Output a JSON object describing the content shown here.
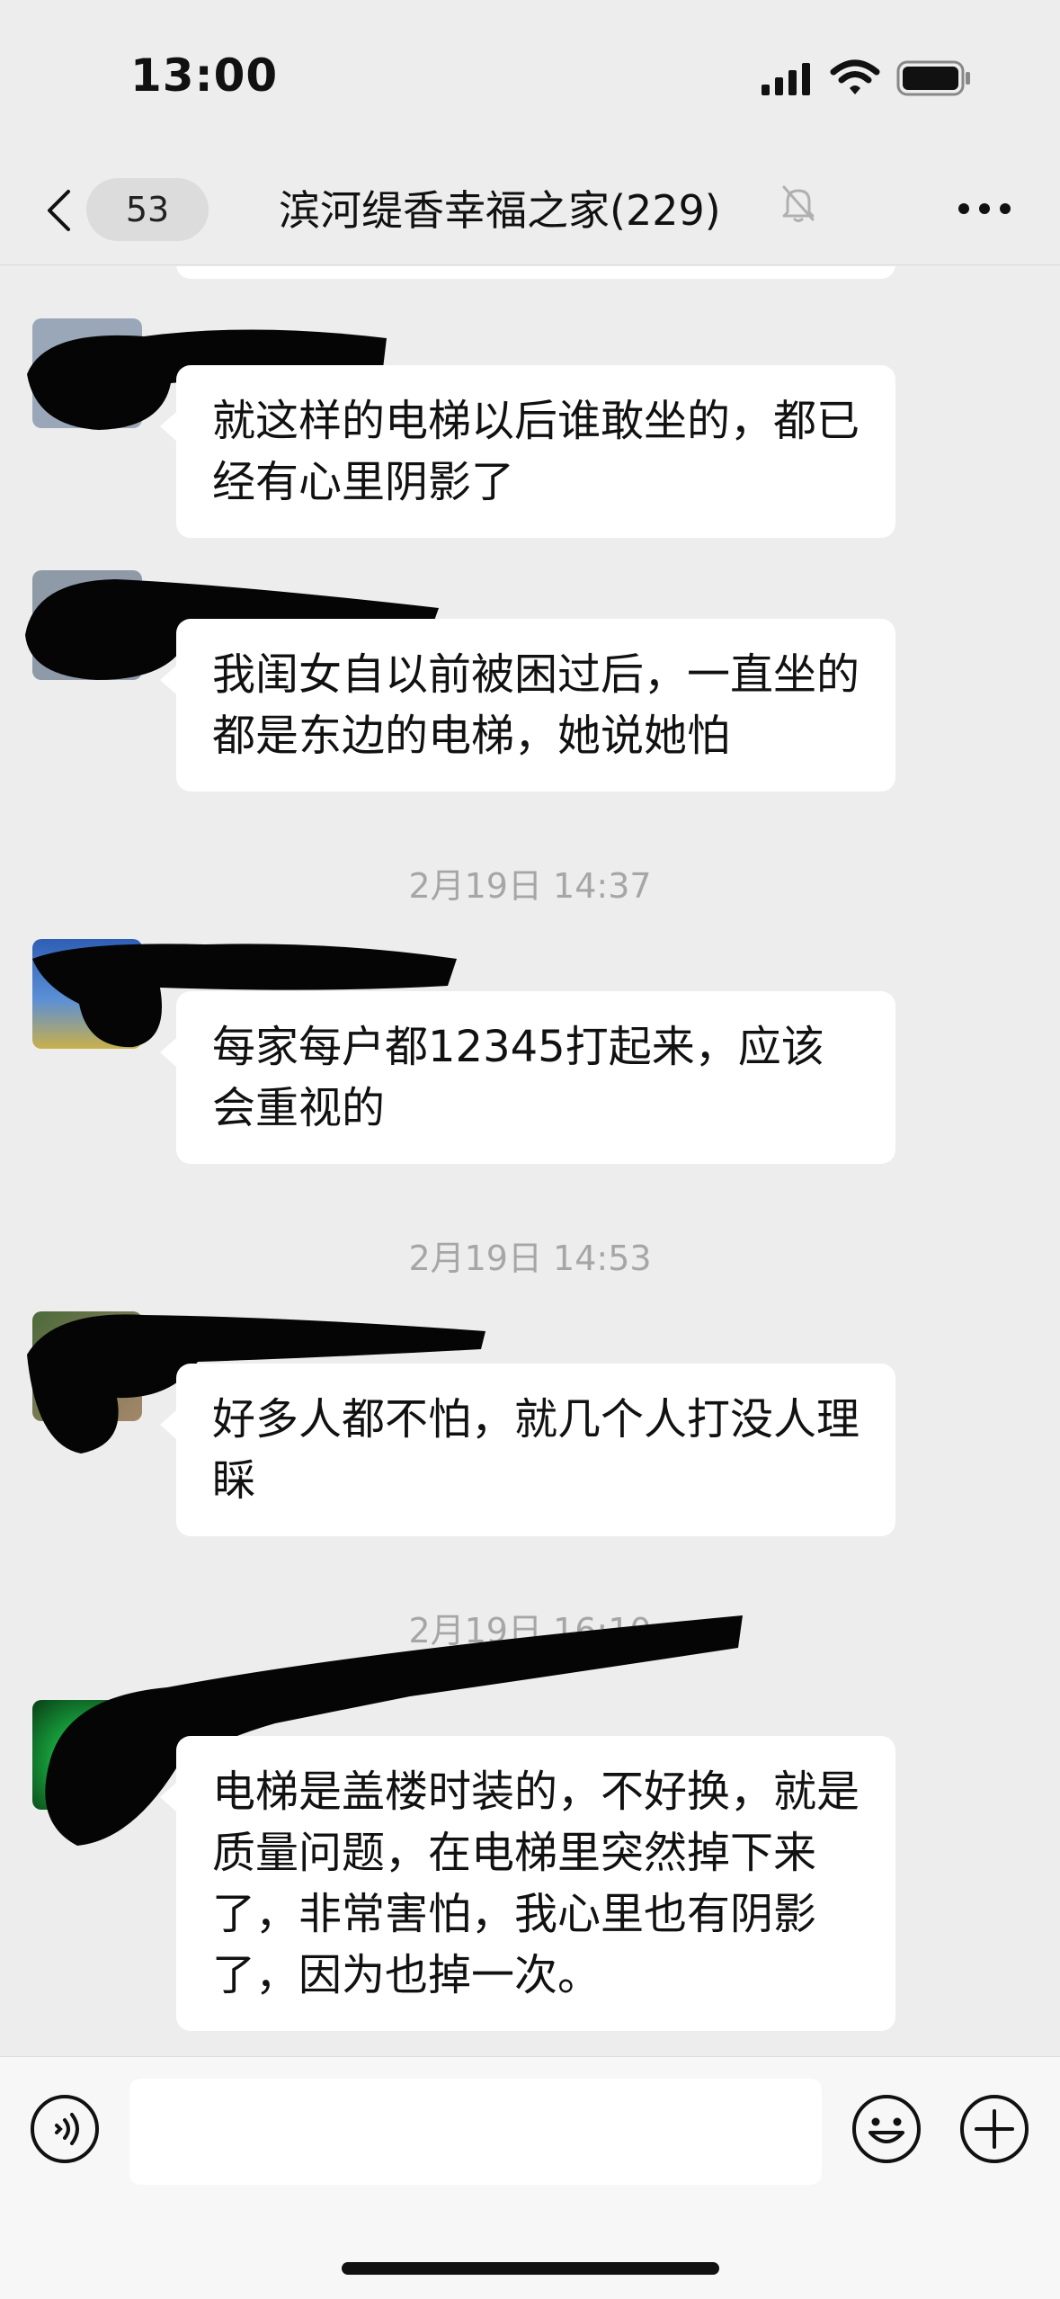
{
  "status_bar": {
    "time": "13:00"
  },
  "nav": {
    "unread_count": "53",
    "title": "滨河缇香幸福之家(229)",
    "muted": true
  },
  "messages": [
    {
      "type": "text",
      "text": "就这样的电梯以后谁敢坐的，都已经有心里阴影了"
    },
    {
      "type": "text",
      "text": "我闺女自以前被困过后，一直坐的都是东边的电梯，她说她怕"
    },
    {
      "type": "time",
      "text": "2月19日 14:37"
    },
    {
      "type": "text",
      "text": "每家每户都12345打起来，应该会重视的"
    },
    {
      "type": "time",
      "text": "2月19日 14:53"
    },
    {
      "type": "text",
      "text": "好多人都不怕，就几个人打没人理睬"
    },
    {
      "type": "time",
      "text": "2月19日 16:10"
    },
    {
      "type": "text",
      "text": "电梯是盖楼时装的，不好换，就是质量问题，在电梯里突然掉下来了，非常害怕，我心里也有阴影了，因为也掉一次。"
    }
  ],
  "input": {
    "placeholder": ""
  },
  "colors": {
    "background": "#ededed",
    "bubble": "#ffffff",
    "timestamp": "#a6a6a6",
    "redaction": "#050505"
  },
  "icons": [
    "back-chevron-icon",
    "mute-bell-icon",
    "more-icon",
    "voice-icon",
    "emoji-icon",
    "plus-icon",
    "signal-icon",
    "wifi-icon",
    "battery-icon"
  ]
}
